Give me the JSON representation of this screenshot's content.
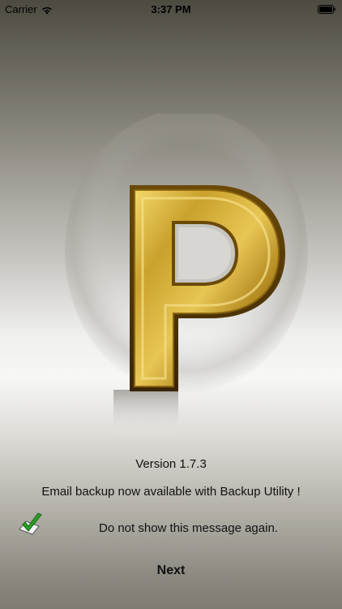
{
  "status_bar": {
    "carrier": "Carrier",
    "time": "3:37 PM",
    "wifi_icon": "wifi-icon",
    "battery_icon": "battery-icon"
  },
  "logo": {
    "letter": "P",
    "color": "#b8901e"
  },
  "version_text": "Version 1.7.3",
  "message_text": "Email backup now available with Backup Utility !",
  "checkbox": {
    "checked": true,
    "label": "Do not show this message again.",
    "check_color": "#2aa12a"
  },
  "next_label": "Next"
}
